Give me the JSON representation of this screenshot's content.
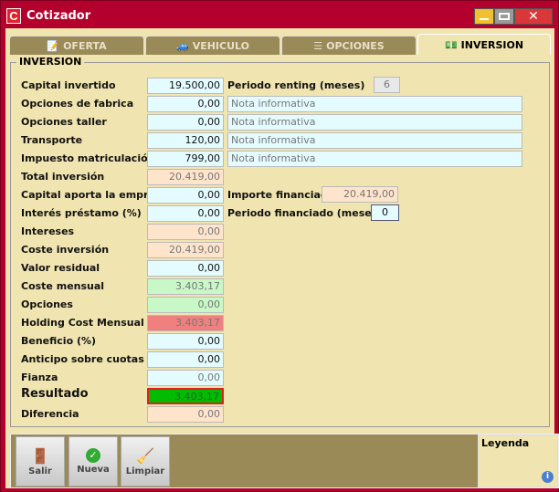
{
  "window": {
    "title": "Cotizador",
    "logo": "C"
  },
  "tabs": [
    {
      "label": "OFERTA",
      "icon": "document-icon"
    },
    {
      "label": "VEHICULO",
      "icon": "car-icon"
    },
    {
      "label": "OPCIONES",
      "icon": "list-icon"
    },
    {
      "label": "INVERSION",
      "icon": "money-icon",
      "active": true
    }
  ],
  "section": "INVERSION",
  "rows": [
    {
      "label": "Capital invertido",
      "value": "19.500,00",
      "kind": "input"
    },
    {
      "label": "Opciones de fabrica",
      "value": "0,00",
      "kind": "input"
    },
    {
      "label": "Opciones taller",
      "value": "0,00",
      "kind": "input"
    },
    {
      "label": "Transporte",
      "value": "120,00",
      "kind": "input"
    },
    {
      "label": "Impuesto matriculación",
      "value": "799,00",
      "kind": "input"
    },
    {
      "label": "Total inversión",
      "value": "20.419,00",
      "kind": "calc"
    },
    {
      "label": "Capital aporta la empresa",
      "value": "0,00",
      "kind": "input"
    },
    {
      "label": "Interés préstamo (%)",
      "value": "0,00",
      "kind": "input"
    },
    {
      "label": "Intereses",
      "value": "0,00",
      "kind": "calc"
    },
    {
      "label": "Coste inversión",
      "value": "20.419,00",
      "kind": "calc"
    },
    {
      "label": "Valor residual",
      "value": "0,00",
      "kind": "input"
    },
    {
      "label": "Coste mensual",
      "value": "3.403,17",
      "kind": "green"
    },
    {
      "label": "Opciones",
      "value": "0,00",
      "kind": "green"
    },
    {
      "label": "Holding Cost Mensual",
      "value": "3.403,17",
      "kind": "red"
    },
    {
      "label": "Beneficio (%)",
      "value": "0,00",
      "kind": "input"
    },
    {
      "label": "Anticipo sobre cuotas",
      "value": "0,00",
      "kind": "input"
    },
    {
      "label": "Fianza",
      "value": "0,00",
      "kind": "readonly"
    },
    {
      "label": "Resultado",
      "value": "3.403,17",
      "kind": "result"
    },
    {
      "label": "Diferencia",
      "value": "0,00",
      "kind": "calc"
    }
  ],
  "notes": [
    "Nota informativa",
    "Nota informativa",
    "Nota informativa",
    "Nota informativa"
  ],
  "periodo_renting": {
    "label": "Periodo renting (meses)",
    "value": "6"
  },
  "importe_financiado": {
    "label": "Importe financiado",
    "value": "20.419,00"
  },
  "periodo_financiado": {
    "label": "Periodo financiado (meses)",
    "value": "0"
  },
  "buttons": [
    {
      "label": "Salir",
      "icon": "exit-door-icon"
    },
    {
      "label": "Nueva",
      "icon": "check-circle-icon"
    },
    {
      "label": "Limpiar",
      "icon": "broom-icon"
    }
  ],
  "leyenda": "Leyenda",
  "colors": {
    "frame": "#b4002c",
    "body": "#f0e4b0",
    "tab": "#9a8a58",
    "input": "#e4fcff",
    "calc": "#ffe4cc",
    "green": "#c8f8c8",
    "red": "#f08080",
    "result": "#00bb00"
  }
}
